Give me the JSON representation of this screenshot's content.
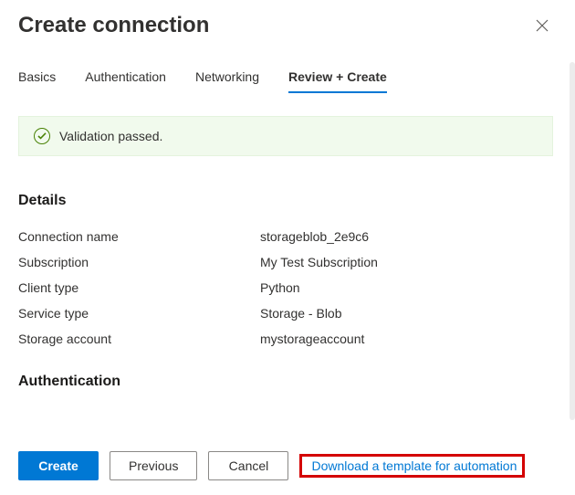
{
  "header": {
    "title": "Create connection"
  },
  "tabs": {
    "basics": "Basics",
    "authentication": "Authentication",
    "networking": "Networking",
    "review": "Review + Create"
  },
  "validation": {
    "message": "Validation passed."
  },
  "details": {
    "heading": "Details",
    "rows": {
      "connection_name": {
        "label": "Connection name",
        "value": "storageblob_2e9c6"
      },
      "subscription": {
        "label": "Subscription",
        "value": "My Test Subscription"
      },
      "client_type": {
        "label": "Client type",
        "value": "Python"
      },
      "service_type": {
        "label": "Service type",
        "value": "Storage - Blob"
      },
      "storage_account": {
        "label": "Storage account",
        "value": "mystorageaccount"
      }
    }
  },
  "authentication": {
    "heading": "Authentication"
  },
  "footer": {
    "create": "Create",
    "previous": "Previous",
    "cancel": "Cancel",
    "download_template": "Download a template for automation"
  }
}
